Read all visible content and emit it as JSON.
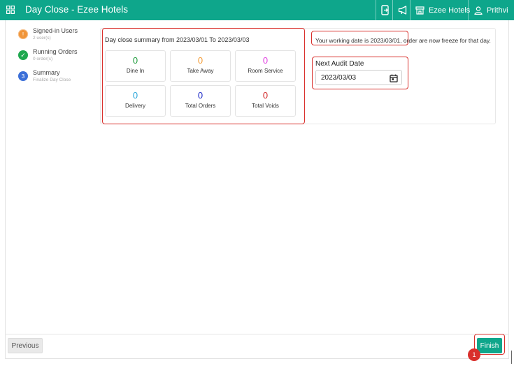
{
  "app": {
    "title": "Day Close - Ezee Hotels",
    "hotel_name": "Ezee Hotels",
    "user_name": "Prithvi"
  },
  "icons": {
    "menu": "grid-icon",
    "phone": "mobile-exit-icon",
    "announce": "megaphone-icon",
    "store": "store-icon",
    "user": "user-icon",
    "calendar": "calendar-icon"
  },
  "steps": [
    {
      "title": "Signed-in Users",
      "subtitle": "2 user(s)",
      "status": "warning",
      "marker": "!",
      "color": "#f0953a"
    },
    {
      "title": "Running Orders",
      "subtitle": "0 order(s)",
      "status": "done",
      "marker": "✓",
      "color": "#1fa84f"
    },
    {
      "title": "Summary",
      "subtitle": "Finalize Day Close",
      "status": "active",
      "marker": "3",
      "color": "#3b6fd8"
    }
  ],
  "summary": {
    "title": "Day close summary from 2023/03/01 To 2023/03/03",
    "tiles": [
      {
        "value": "0",
        "label": "Dine In",
        "color": "#1d9a3a"
      },
      {
        "value": "0",
        "label": "Take Away",
        "color": "#f39a33"
      },
      {
        "value": "0",
        "label": "Room Service",
        "color": "#e040e0"
      },
      {
        "value": "0",
        "label": "Delivery",
        "color": "#29a6d9"
      },
      {
        "value": "0",
        "label": "Total Orders",
        "color": "#1d2ac7"
      },
      {
        "value": "0",
        "label": "Total Voids",
        "color": "#d22a2a"
      }
    ]
  },
  "working": {
    "message": "Your working date is 2023/03/01, order are now freeze for that day.",
    "next_audit_label": "Next Audit Date",
    "next_audit_value": "2023/03/03"
  },
  "footer": {
    "previous_label": "Previous",
    "finish_label": "Finish",
    "badge": "1"
  },
  "colors": {
    "brand": "#0ea68b",
    "highlight": "#d9302c"
  }
}
